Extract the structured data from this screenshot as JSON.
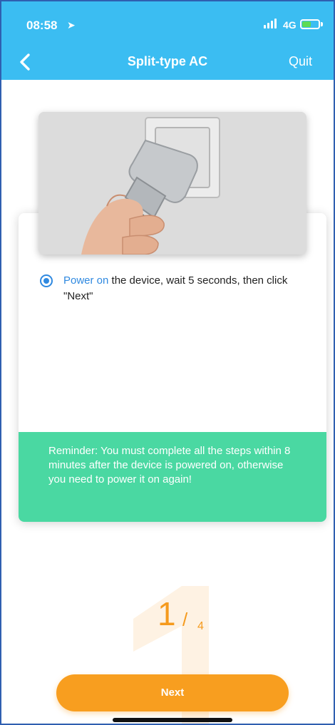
{
  "status_bar": {
    "time": "08:58",
    "network": "4G",
    "location_icon": "location-arrow-icon",
    "battery_state": "charging"
  },
  "nav": {
    "title": "Split-type AC",
    "quit_label": "Quit",
    "back_icon": "chevron-left-icon"
  },
  "instruction": {
    "highlight": "Power on",
    "text": " the device, wait 5 seconds, then click \"Next\"",
    "selected": true
  },
  "reminder": {
    "text": "Reminder: You must complete all the steps within 8 minutes after the device is powered on, otherwise you need  to power it on again!"
  },
  "step": {
    "current": "1",
    "separator": "/",
    "total": "4"
  },
  "next_button": {
    "label": "Next"
  },
  "colors": {
    "header": "#3bbdf2",
    "accent_blue": "#2f89e0",
    "reminder_green": "#4ad8a2",
    "orange": "#f89e1f"
  }
}
